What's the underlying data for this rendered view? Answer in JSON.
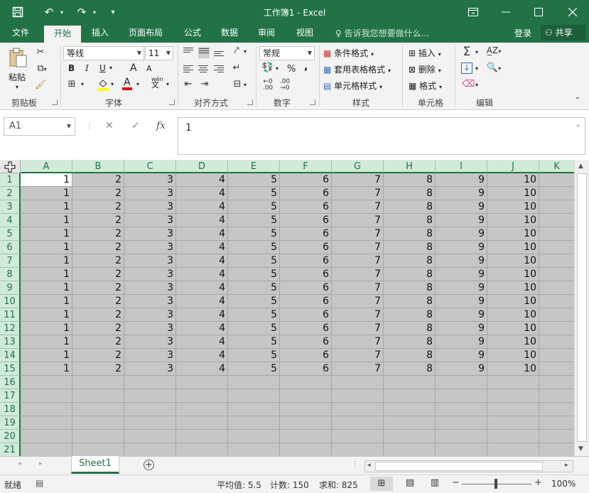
{
  "window": {
    "title": "工作簿1 - Excel"
  },
  "menu": {
    "tabs": [
      "文件",
      "开始",
      "插入",
      "页面布局",
      "公式",
      "数据",
      "审阅",
      "视图"
    ],
    "tell_me": "告诉我您想要做什么...",
    "login": "登录",
    "share": "共享"
  },
  "ribbon": {
    "paste": "粘贴",
    "font_name": "等线",
    "font_size": "11",
    "number_format": "常规",
    "cond_format": "条件格式",
    "table_format": "套用表格格式",
    "cell_style": "单元格样式",
    "insert": "插入",
    "delete": "删除",
    "format": "格式",
    "groups": [
      "剪贴板",
      "字体",
      "对齐方式",
      "数字",
      "样式",
      "单元格",
      "编辑"
    ],
    "bold": "B",
    "italic": "I",
    "underline": "U",
    "font_grow": "A",
    "font_shrink": "A",
    "font_color": "A",
    "percent": "%",
    "comma": ",",
    "phonetic": "wén",
    "phonetic_char": "文"
  },
  "formula_bar": {
    "name_box": "A1",
    "formula": "1",
    "fx": "fx"
  },
  "grid": {
    "columns": [
      "A",
      "B",
      "C",
      "D",
      "E",
      "F",
      "G",
      "H",
      "I",
      "J",
      "K"
    ],
    "row_numbers": [
      "1",
      "2",
      "3",
      "4",
      "5",
      "6",
      "7",
      "8",
      "9",
      "10",
      "11",
      "12",
      "13",
      "14",
      "15",
      "16",
      "17",
      "18",
      "19",
      "20",
      "21"
    ],
    "rows": [
      [
        "1",
        "2",
        "3",
        "4",
        "5",
        "6",
        "7",
        "8",
        "9",
        "10"
      ],
      [
        "1",
        "2",
        "3",
        "4",
        "5",
        "6",
        "7",
        "8",
        "9",
        "10"
      ],
      [
        "1",
        "2",
        "3",
        "4",
        "5",
        "6",
        "7",
        "8",
        "9",
        "10"
      ],
      [
        "1",
        "2",
        "3",
        "4",
        "5",
        "6",
        "7",
        "8",
        "9",
        "10"
      ],
      [
        "1",
        "2",
        "3",
        "4",
        "5",
        "6",
        "7",
        "8",
        "9",
        "10"
      ],
      [
        "1",
        "2",
        "3",
        "4",
        "5",
        "6",
        "7",
        "8",
        "9",
        "10"
      ],
      [
        "1",
        "2",
        "3",
        "4",
        "5",
        "6",
        "7",
        "8",
        "9",
        "10"
      ],
      [
        "1",
        "2",
        "3",
        "4",
        "5",
        "6",
        "7",
        "8",
        "9",
        "10"
      ],
      [
        "1",
        "2",
        "3",
        "4",
        "5",
        "6",
        "7",
        "8",
        "9",
        "10"
      ],
      [
        "1",
        "2",
        "3",
        "4",
        "5",
        "6",
        "7",
        "8",
        "9",
        "10"
      ],
      [
        "1",
        "2",
        "3",
        "4",
        "5",
        "6",
        "7",
        "8",
        "9",
        "10"
      ],
      [
        "1",
        "2",
        "3",
        "4",
        "5",
        "6",
        "7",
        "8",
        "9",
        "10"
      ],
      [
        "1",
        "2",
        "3",
        "4",
        "5",
        "6",
        "7",
        "8",
        "9",
        "10"
      ],
      [
        "1",
        "2",
        "3",
        "4",
        "5",
        "6",
        "7",
        "8",
        "9",
        "10"
      ],
      [
        "1",
        "2",
        "3",
        "4",
        "5",
        "6",
        "7",
        "8",
        "9",
        "10"
      ]
    ]
  },
  "sheets": {
    "active": "Sheet1"
  },
  "status": {
    "ready": "就绪",
    "average": "平均值: 5.5",
    "count": "计数: 150",
    "sum": "求和: 825",
    "zoom": "100%"
  },
  "colors": {
    "accent": "#217346",
    "selection": "#c6c6c6"
  }
}
